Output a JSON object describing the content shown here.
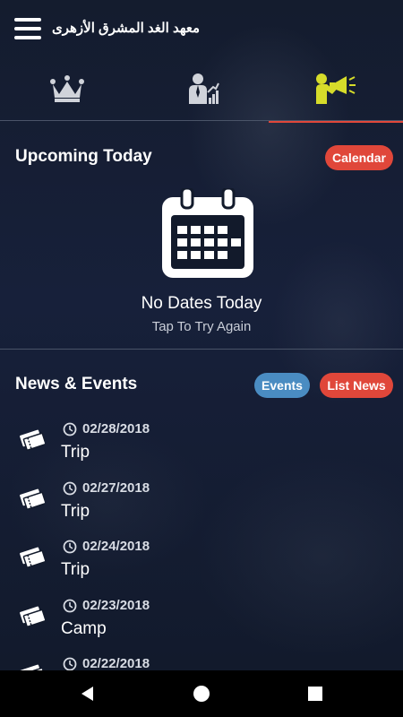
{
  "app": {
    "title": "معهد الغد المشرق الأزهرى"
  },
  "tabs": [
    {
      "icon": "crown-icon",
      "active": false
    },
    {
      "icon": "person-chart-icon",
      "active": false
    },
    {
      "icon": "megaphone-person-icon",
      "active": true
    }
  ],
  "upcoming": {
    "title": "Upcoming Today",
    "calendar_button": "Calendar",
    "empty_title": "No Dates Today",
    "empty_subtitle": "Tap To Try Again"
  },
  "news": {
    "title": "News & Events",
    "events_button": "Events",
    "list_news_button": "List News",
    "items": [
      {
        "date": "02/28/2018",
        "title": "Trip"
      },
      {
        "date": "02/27/2018",
        "title": "Trip"
      },
      {
        "date": "02/24/2018",
        "title": "Trip"
      },
      {
        "date": "02/23/2018",
        "title": "Camp"
      },
      {
        "date": "02/22/2018",
        "title": ""
      }
    ]
  },
  "colors": {
    "accent_red": "#e0473a",
    "accent_blue": "#4a8cc2",
    "active_tab_icon": "#d6dc2a",
    "inactive_tab_icon": "#d0d3da"
  }
}
